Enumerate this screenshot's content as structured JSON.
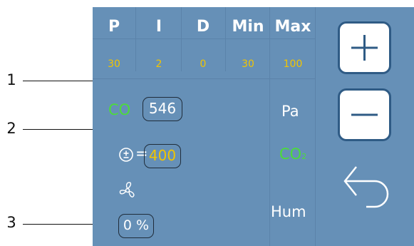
{
  "pid_table": {
    "headers": [
      "P",
      "I",
      "D",
      "Min",
      "Max"
    ],
    "values": [
      "30",
      "2",
      "0",
      "30",
      "100"
    ]
  },
  "co_row": {
    "label": "CO",
    "value": "546"
  },
  "setpoint_row": {
    "equals": "=",
    "value": "400"
  },
  "fan_row": {
    "value": "0 %"
  },
  "side_labels": {
    "pressure": "Pa",
    "co2_main": "CO",
    "co2_sub": "2",
    "humidity": "Hum"
  },
  "callouts": [
    "1",
    "2",
    "3"
  ],
  "icons": {
    "plus": "plus-icon",
    "minus": "minus-icon",
    "back": "back-arrow-icon",
    "setpoint": "plus-minus-circle-icon",
    "fan": "fan-icon"
  },
  "colors": {
    "panel": "#6690b7",
    "header": "#ffffff",
    "pid_value": "#f2c500",
    "co_label": "#4ddb3a",
    "setpoint_value": "#f2c500",
    "co2": "#4ddb3a"
  }
}
